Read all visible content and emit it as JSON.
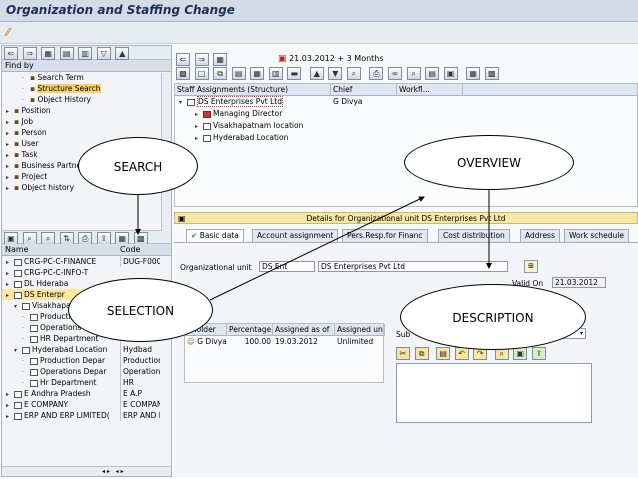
{
  "window": {
    "title": "Organization and Staffing Change"
  },
  "left_top": {
    "header": "Find by",
    "items": [
      {
        "label": "Search Term",
        "indent": 2,
        "icon": "search-icon"
      },
      {
        "label": "Structure Search",
        "indent": 2,
        "icon": "search-icon",
        "highlight": true
      },
      {
        "label": "Object History",
        "indent": 2,
        "icon": "search-icon"
      },
      {
        "label": "Position",
        "indent": 0,
        "icon": "position-icon"
      },
      {
        "label": "Job",
        "indent": 0,
        "icon": "job-icon"
      },
      {
        "label": "Person",
        "indent": 0,
        "icon": "person-icon"
      },
      {
        "label": "User",
        "indent": 0,
        "icon": "user-icon"
      },
      {
        "label": "Task",
        "indent": 0,
        "icon": "task-icon"
      },
      {
        "label": "Business Partner",
        "indent": 0,
        "icon": "partner-icon"
      },
      {
        "label": "Project",
        "indent": 0,
        "icon": "project-icon"
      },
      {
        "label": "Object history",
        "indent": 0,
        "icon": "history-icon"
      }
    ]
  },
  "left_bottom": {
    "col_name": "Name",
    "col_code": "Code",
    "rows": [
      {
        "name": "CRG-PC-C-FINANCE",
        "code": "DUG-F000",
        "indent": 0
      },
      {
        "name": "CRG-PC-C-INFO-T",
        "code": "",
        "indent": 0
      },
      {
        "name": "DL Hderaba",
        "code": "",
        "indent": 0
      },
      {
        "name": "DS Enterpr",
        "code": "",
        "indent": 0,
        "selected": true
      },
      {
        "name": "Visakhapa",
        "code": "",
        "indent": 1
      },
      {
        "name": "Production",
        "code": "",
        "indent": 2
      },
      {
        "name": "Operations Depar",
        "code": "Operation1",
        "indent": 2
      },
      {
        "name": "HR Department",
        "code": "\\HR1",
        "indent": 2
      },
      {
        "name": "Hyderabad Location",
        "code": "Hydbad",
        "indent": 1
      },
      {
        "name": "Production Depar",
        "code": "Production",
        "indent": 2
      },
      {
        "name": "Operations Depar",
        "code": "Operation",
        "indent": 2
      },
      {
        "name": "Hr Department",
        "code": "HR",
        "indent": 2
      },
      {
        "name": "E Andhra Pradesh",
        "code": "E A.P",
        "indent": 0
      },
      {
        "name": "E COMPANY",
        "code": "E COMPAN",
        "indent": 0
      },
      {
        "name": "ERP AND ERP LIMITED(",
        "code": "ERP AND E",
        "indent": 0
      }
    ]
  },
  "overview": {
    "date_text": "21.03.2012 + 3 Months",
    "col_staff": "Staff Assignments (Structure)",
    "col_chief": "Chief",
    "col_workflow": "Workfl...",
    "rows": [
      {
        "label": "DS Enterprises Pvt Ltd",
        "chief": "G Divya",
        "indent": 0
      },
      {
        "label": "Managing Director",
        "chief": "",
        "indent": 2
      },
      {
        "label": "Visakhapatnam location",
        "chief": "",
        "indent": 2
      },
      {
        "label": "Hyderabad Location",
        "chief": "",
        "indent": 2
      }
    ]
  },
  "details": {
    "bar_text": "Details for Organizational unit DS Enterprises Pvt Ltd",
    "tabs": [
      "Basic data",
      "Account assignment",
      "Pers.Resp.for Financ",
      "Cost distribution",
      "Address",
      "Work schedule"
    ],
    "org_unit_label": "Organizational unit",
    "org_unit_code": "DS Ent",
    "org_unit_name": "DS Enterprises Pvt Ltd",
    "valid_on_label": "Valid On",
    "valid_on_value": "21.03.2012",
    "staff_label": "ff",
    "holder_cols": [
      "Holder",
      "Percentage",
      "Assigned as of",
      "Assigned un"
    ],
    "holder_row": [
      "G Divya",
      "100.00",
      "19.03.2012",
      "Unlimited"
    ],
    "desc_label": "Sub"
  },
  "callouts": {
    "search": "SEARCH",
    "overview": "OVERVIEW",
    "selection": "SELECTION",
    "description": "DESCRIPTION"
  }
}
